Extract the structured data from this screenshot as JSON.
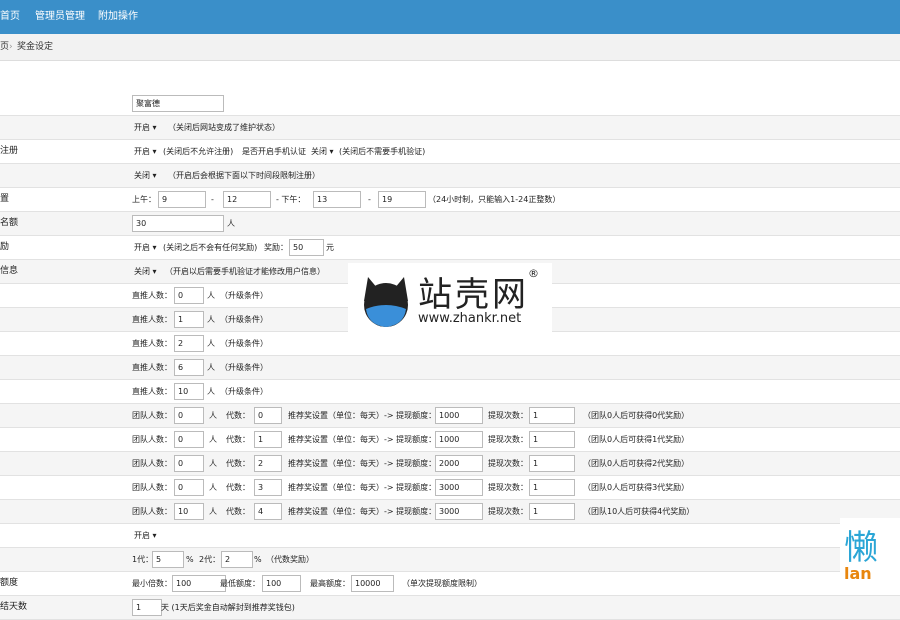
{
  "nav": {
    "tabs": [
      "首页",
      "管理员管理",
      "附加操作"
    ]
  },
  "breadcrumb": {
    "home": "页",
    "sep": "›",
    "current": "奖金设定"
  },
  "site_name": {
    "label": "",
    "value": "聚富德"
  },
  "maintenance": {
    "label": "",
    "select": "开启 ▾",
    "note": "（关闭后网站变成了维护状态）"
  },
  "register": {
    "label": "注册",
    "select": "开启 ▾",
    "note": "(关闭后不允许注册)",
    "label2": "是否开启手机认证",
    "select2": "关闭 ▾",
    "note2": "(关闭后不需要手机验证)"
  },
  "time_limit": {
    "label": "",
    "select": "关闭 ▾",
    "note": "（开启后会根据下面以下时间段限制注册）"
  },
  "time_range": {
    "label": "置",
    "am_label": "上午：",
    "am_start": "9",
    "dash": "-",
    "am_end": "12",
    "pm_label": "- 下午：",
    "pm_start": "13",
    "pm_end": "19",
    "note": "（24小时制，只能输入1-24正整数）"
  },
  "quota": {
    "label": "名额",
    "value": "30",
    "unit": "人"
  },
  "reward": {
    "label": "励",
    "select": "开启 ▾",
    "note": "(关闭之后不会有任何奖励)",
    "amount_label": "奖励：",
    "amount": "50",
    "unit": "元"
  },
  "info": {
    "label": "信息",
    "select": "关闭 ▾",
    "note": "（开启以后需要手机验证才能修改用户信息）"
  },
  "direct_levels": [
    {
      "label": "直推人数：",
      "value": "0",
      "unit": "人",
      "note": "（升级条件）"
    },
    {
      "label": "直推人数：",
      "value": "1",
      "unit": "人",
      "note": "（升级条件）"
    },
    {
      "label": "直推人数：",
      "value": "2",
      "unit": "人",
      "note": "（升级条件）"
    },
    {
      "label": "直推人数：",
      "value": "6",
      "unit": "人",
      "note": "（升级条件）"
    },
    {
      "label": "直推人数：",
      "value": "10",
      "unit": "人",
      "note": "（升级条件）"
    }
  ],
  "team_levels": [
    {
      "team_label": "团队人数：",
      "team": "0",
      "unit": "人",
      "gen_label": "代数：",
      "gen": "0",
      "rec_label": "推荐奖设置（单位：每天）-> 提现额度：",
      "amount": "1000",
      "times_label": "提现次数：",
      "times": "1",
      "note": "（团队0人后可获得0代奖励）"
    },
    {
      "team_label": "团队人数：",
      "team": "0",
      "unit": "人",
      "gen_label": "代数：",
      "gen": "1",
      "rec_label": "推荐奖设置（单位：每天）-> 提现额度：",
      "amount": "1000",
      "times_label": "提现次数：",
      "times": "1",
      "note": "（团队0人后可获得1代奖励）"
    },
    {
      "team_label": "团队人数：",
      "team": "0",
      "unit": "人",
      "gen_label": "代数：",
      "gen": "2",
      "rec_label": "推荐奖设置（单位：每天）-> 提现额度：",
      "amount": "2000",
      "times_label": "提现次数：",
      "times": "1",
      "note": "（团队0人后可获得2代奖励）"
    },
    {
      "team_label": "团队人数：",
      "team": "0",
      "unit": "人",
      "gen_label": "代数：",
      "gen": "3",
      "rec_label": "推荐奖设置（单位：每天）-> 提现额度：",
      "amount": "3000",
      "times_label": "提现次数：",
      "times": "1",
      "note": "（团队0人后可获得3代奖励）"
    },
    {
      "team_label": "团队人数：",
      "team": "10",
      "unit": "人",
      "gen_label": "代数：",
      "gen": "4",
      "rec_label": "推荐奖设置（单位：每天）-> 提现额度：",
      "amount": "3000",
      "times_label": "提现次数：",
      "times": "1",
      "note": "（团队10人后可获得4代奖励）"
    }
  ],
  "team_switch": {
    "label": "",
    "select": "开启 ▾"
  },
  "generations": {
    "label": "",
    "g1_label": "1代：",
    "g1": "5",
    "pct": "%",
    "g2_label": "2代：",
    "g2": "2",
    "note": "（代数奖励）"
  },
  "withdraw": {
    "label": "额度",
    "min_mult_label": "最小倍数：",
    "min_mult": "100",
    "min_label": "最低额度：",
    "min": "100",
    "max_label": "最高额度：",
    "max": "10000",
    "note": "（单次提现额度限制）"
  },
  "settle": {
    "label": "结天数",
    "value": "1",
    "note": "天 (1天后奖金自动解封到推荐奖钱包)"
  },
  "watermark": {
    "brand": "站壳网",
    "reg": "®",
    "url": "www.zhankr.net"
  },
  "watermark2": {
    "a": "懒",
    "b": "lan"
  }
}
